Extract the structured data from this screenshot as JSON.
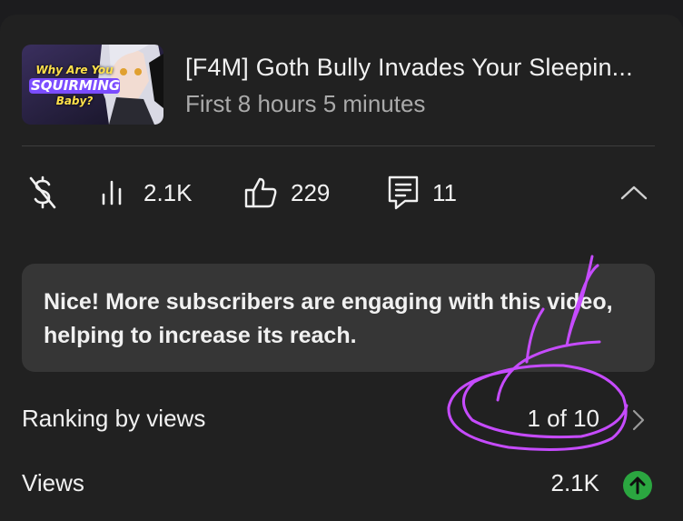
{
  "video": {
    "thumbnail_text_line1": "Why Are You",
    "thumbnail_text_line2": "SQUIRMING",
    "thumbnail_text_line3": "Baby?",
    "title": "[F4M] Goth Bully Invades Your Sleepin...",
    "subtitle": "First 8 hours 5 minutes"
  },
  "stats": {
    "monetization_icon": "no-dollar-icon",
    "views": "2.1K",
    "likes": "229",
    "comments": "11"
  },
  "notice": {
    "text": "Nice! More subscribers are engaging with this video, helping to increase its reach."
  },
  "ranking": {
    "label": "Ranking by views",
    "value": "1 of 10"
  },
  "views_row": {
    "label": "Views",
    "value": "2.1K",
    "trend_icon": "arrow-up-icon",
    "trend_color": "#2ba640"
  },
  "colors": {
    "background": "#212121",
    "card": "#363636",
    "annotation": "#c64bff"
  }
}
